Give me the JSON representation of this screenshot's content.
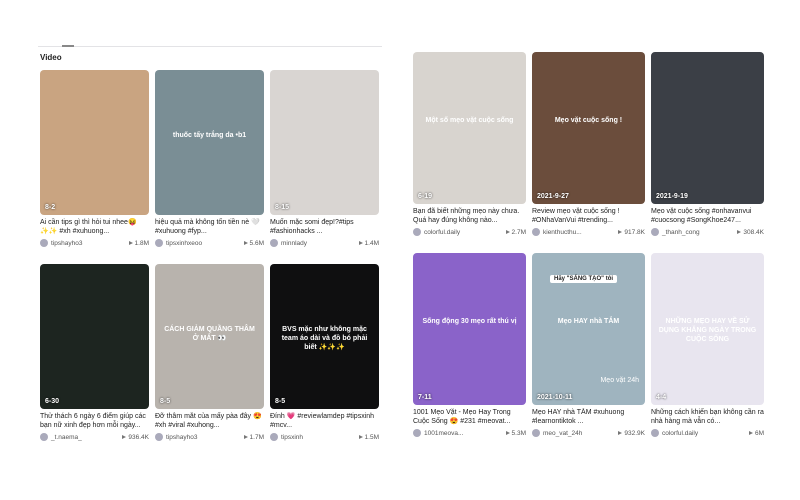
{
  "left": {
    "section_label": "Video",
    "cards": [
      {
        "label": "8-2",
        "caption": "Ai cần tips gì thì hỏi tui nhee😝 ✨✨ #xh #xuhuong...",
        "user": "tipshayho3",
        "views": "1.8M",
        "bg": "#c9a481"
      },
      {
        "label": "",
        "caption": "hiệu quả mà không tốn tiền nè 🤍 #xuhuong #fyp...",
        "user": "tipsxinhxeoo",
        "views": "5.6M",
        "bg": "#7a8e95",
        "overlay": "thuốc tẩy trắng da  •b1"
      },
      {
        "label": "8-15",
        "caption": "Muốn mặc somi đẹp!?#tips #fashionhacks ...",
        "user": "minnlady",
        "views": "1.4M",
        "bg": "#d9d5d2"
      },
      {
        "label": "6-30",
        "caption": "Thử thách 6 ngày 6 điểm giúp các bạn nữ xinh đẹp hơn mỗi ngày...",
        "user": "_t.naema_",
        "views": "936.4K",
        "bg": "#1d2520"
      },
      {
        "label": "8-5",
        "caption": "Đỡ thâm mắt của mấy pàa đây 😍 #xh #viral #xuhong...",
        "user": "tipshayho3",
        "views": "1.7M",
        "bg": "#b8b3ad",
        "overlay": "CÁCH GIẢM QUẦNG THÂM Ở MẮT 👀"
      },
      {
        "label": "8-5",
        "caption": "Đính 💗 #reviewlamdep #tipsxinh #mcv...",
        "user": "tipsxinh",
        "views": "1.5M",
        "bg": "#0f0f10",
        "overlay": "BVS mặc như không mặc team áo dài và đồ bó phải biết ✨✨✨"
      }
    ]
  },
  "right": {
    "cards": [
      {
        "label": "6-19",
        "caption": "Bạn đã biết những mẹo này chưa. Quá hay đúng không nào...",
        "user": "colorful.daily",
        "views": "2.7M",
        "bg": "#d8d4cf",
        "overlay": "Một số mẹo vặt cuộc sống"
      },
      {
        "label": "2021-9-27",
        "caption": "Review mẹo vặt cuộc sống ! #ONhaVanVui #trending...",
        "user": "kienthucthu...",
        "views": "917.8K",
        "bg": "#6b4d3c",
        "overlay": "Mẹo vặt cuộc sống !"
      },
      {
        "label": "2021-9-19",
        "caption": "Mẹo vặt cuộc sống #onhavanvui #cuocsong #SongKhoe247...",
        "user": "_thanh_cong",
        "views": "308.4K",
        "bg": "#3b3f46"
      },
      {
        "label": "7-11",
        "caption": "1001 Mẹo Vặt - Mẹo Hay Trong Cuộc Sống 😍 #231 #meovat...",
        "user": "1001meova...",
        "views": "5.3M",
        "bg": "#8a63c9",
        "overlay": "Sống động 30 mẹo rất thú vị"
      },
      {
        "label": "2021-10-11",
        "caption": "Mẹo HAY nhà TẮM #xuhuong #learnontiktok ...",
        "user": "meo_vat_24h",
        "views": "932.9K",
        "bg": "#9fb4bf",
        "overlay": "Mẹo HAY nhà TẮM",
        "overlay2": "Hãy \"SÁNG TẠO\" tôi",
        "overlay3": "Mẹo vặt 24h"
      },
      {
        "label": "4-4",
        "caption": "Những cách khiến bạn không cần ra nhà hàng mà vẫn có...",
        "user": "colorful.daily",
        "views": "6M",
        "bg": "#e8e5ef",
        "overlay": "NHỮNG MẸO HAY VỀ SỬ DỤNG KHĂNG NGÀY TRONG CUỘC SỐNG"
      }
    ]
  }
}
